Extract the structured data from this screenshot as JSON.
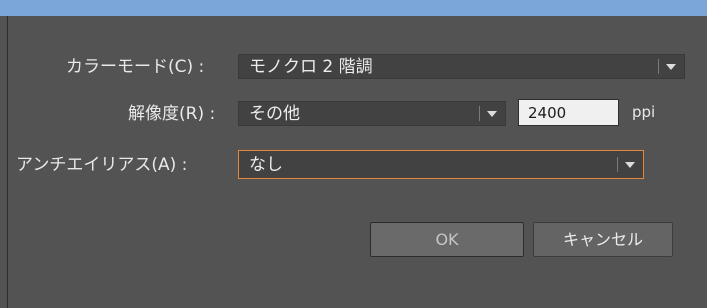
{
  "dialog": {
    "color_mode": {
      "label": "カラーモード(C) :",
      "value": "モノクロ 2 階調"
    },
    "resolution": {
      "label": "解像度(R) :",
      "value": "その他",
      "custom_value": "2400",
      "unit": "ppi"
    },
    "antialias": {
      "label": "アンチエイリアス(A) :",
      "value": "なし"
    },
    "buttons": {
      "ok": "OK",
      "cancel": "キャンセル"
    }
  },
  "colors": {
    "background": "#535353",
    "title_strip": "#7aa6d9",
    "focus_border": "#e5873a"
  },
  "icons": {
    "dropdown": "chevron-down-icon"
  }
}
